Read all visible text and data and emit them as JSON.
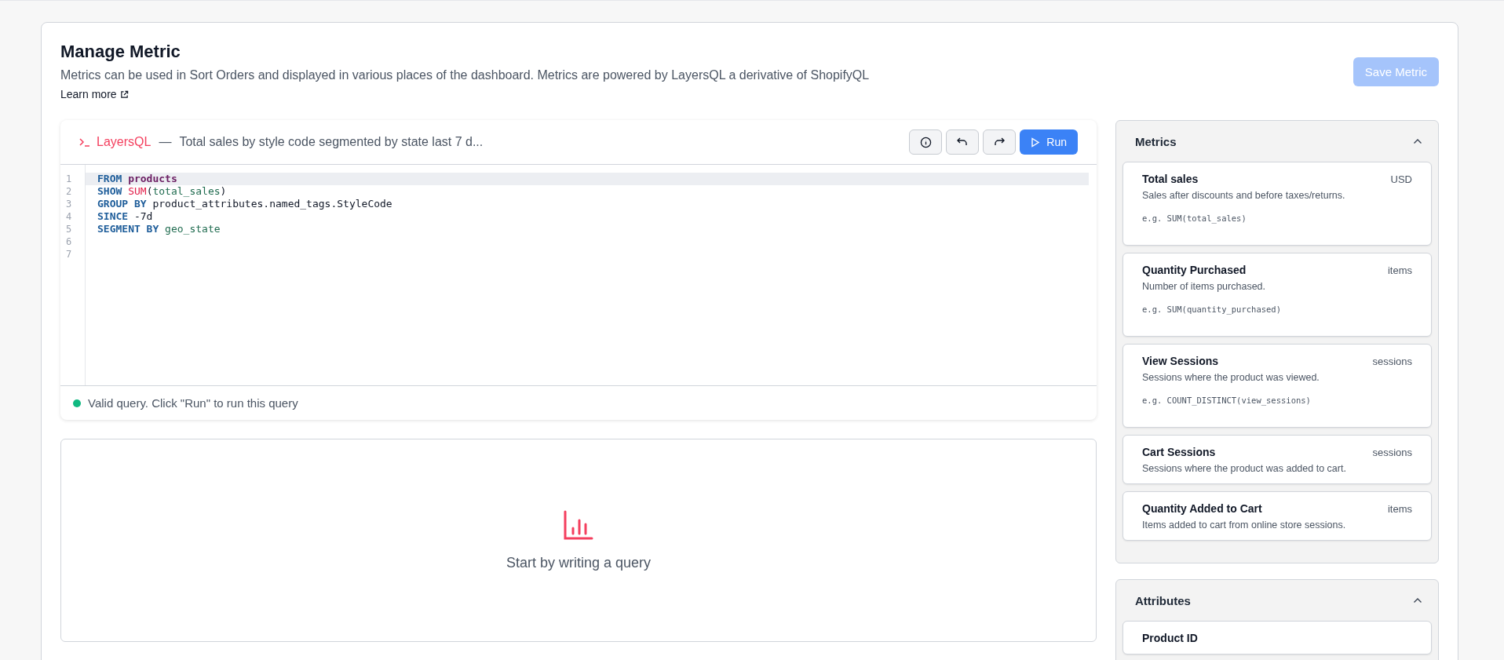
{
  "page": {
    "title": "Manage Metric",
    "description": "Metrics can be used in Sort Orders and displayed in various places of the dashboard. Metrics are powered by LayersQL a derivative of ShopifyQL",
    "learn_more": "Learn more",
    "save_button": {
      "label": "Save Metric",
      "disabled": true
    }
  },
  "editor": {
    "brand": "LayersQL",
    "separator": "—",
    "query_title": "Total sales by style code segmented by state last 7 d...",
    "run_button": "Run",
    "lines": [
      {
        "number": "1",
        "active": true,
        "tokens": [
          {
            "kind": "keyword",
            "text": "FROM"
          },
          {
            "kind": "table",
            "text": " products"
          }
        ]
      },
      {
        "number": "2",
        "active": false,
        "tokens": [
          {
            "kind": "keyword",
            "text": "SHOW"
          },
          {
            "kind": "function",
            "text": " SUM"
          },
          {
            "kind": "plain",
            "text": "("
          },
          {
            "kind": "field",
            "text": "total_sales"
          },
          {
            "kind": "plain",
            "text": ")"
          }
        ]
      },
      {
        "number": "3",
        "active": false,
        "tokens": [
          {
            "kind": "keyword",
            "text": "GROUP BY"
          },
          {
            "kind": "plain",
            "text": " product_attributes.named_tags.StyleCode"
          }
        ]
      },
      {
        "number": "4",
        "active": false,
        "tokens": [
          {
            "kind": "keyword",
            "text": "SINCE"
          },
          {
            "kind": "plain",
            "text": " -7d"
          }
        ]
      },
      {
        "number": "5",
        "active": false,
        "tokens": [
          {
            "kind": "keyword",
            "text": "SEGMENT BY"
          },
          {
            "kind": "field",
            "text": " geo_state"
          }
        ]
      },
      {
        "number": "6",
        "active": false
      },
      {
        "number": "7",
        "active": false
      }
    ],
    "status": {
      "valid": true,
      "message": "Valid query. Click \"Run\" to run this query"
    }
  },
  "results": {
    "empty_message": "Start by writing a query"
  },
  "panels": [
    {
      "title": "Metrics",
      "expanded": true,
      "items": [
        {
          "name": "Total sales",
          "unit": "USD",
          "description": "Sales after discounts and before taxes/returns.",
          "example": "e.g. SUM(total_sales)"
        },
        {
          "name": "Quantity Purchased",
          "unit": "items",
          "description": "Number of items purchased.",
          "example": "e.g. SUM(quantity_purchased)"
        },
        {
          "name": "View Sessions",
          "unit": "sessions",
          "description": "Sessions where the product was viewed.",
          "example": "e.g. COUNT_DISTINCT(view_sessions)"
        },
        {
          "name": "Cart Sessions",
          "unit": "sessions",
          "description": "Sessions where the product was added to cart."
        },
        {
          "name": "Quantity Added to Cart",
          "unit": "items",
          "description": "Items added to cart from online store sessions."
        }
      ]
    },
    {
      "title": "Attributes",
      "expanded": true,
      "items": [
        {
          "name": "Product ID"
        }
      ]
    }
  ]
}
